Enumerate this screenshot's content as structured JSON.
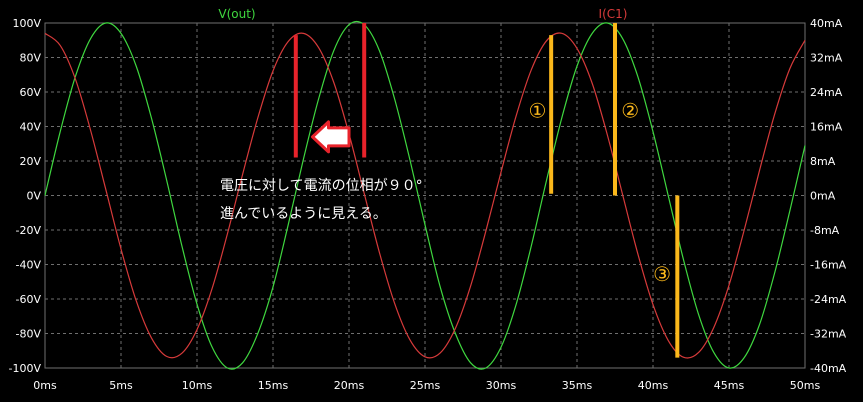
{
  "chart_data": {
    "type": "line",
    "x_axis": {
      "min": 0,
      "max": 50,
      "unit": "ms",
      "ticks": [
        "0ms",
        "5ms",
        "10ms",
        "15ms",
        "20ms",
        "25ms",
        "30ms",
        "35ms",
        "40ms",
        "45ms",
        "50ms"
      ],
      "tick_values": [
        0,
        5,
        10,
        15,
        20,
        25,
        30,
        35,
        40,
        45,
        50
      ]
    },
    "y_left": {
      "min": -100,
      "max": 100,
      "ticks": [
        "100V",
        "80V",
        "60V",
        "40V",
        "20V",
        "0V",
        "-20V",
        "-40V",
        "-60V",
        "-80V",
        "-100V"
      ],
      "tick_values": [
        100,
        80,
        60,
        40,
        20,
        0,
        -20,
        -40,
        -60,
        -80,
        -100
      ]
    },
    "y_right": {
      "min": -40,
      "max": 40,
      "ticks": [
        "40mA",
        "32mA",
        "24mA",
        "16mA",
        "8mA",
        "0mA",
        "-8mA",
        "-16mA",
        "-24mA",
        "-32mA",
        "-40mA"
      ],
      "tick_values": [
        40,
        32,
        24,
        16,
        8,
        0,
        -8,
        -16,
        -24,
        -32,
        -40
      ]
    },
    "grid": true,
    "series": [
      {
        "name": "V(out)",
        "color": "#3fd73f",
        "axis": "left",
        "x": [
          0,
          1,
          2,
          3,
          4,
          5,
          6,
          7,
          8,
          9,
          10,
          11,
          12,
          13,
          14,
          15,
          16,
          17,
          18,
          19,
          20,
          21,
          22,
          23,
          24,
          25,
          26,
          27,
          28,
          29,
          30,
          31,
          32,
          33,
          34,
          35,
          36,
          37,
          38,
          39,
          40,
          41,
          42,
          43,
          44,
          45,
          46,
          47,
          48,
          49,
          50
        ],
        "y": [
          0,
          37,
          69,
          91,
          100,
          94,
          75,
          45,
          9,
          -29,
          -63,
          -88,
          -100,
          -97,
          -80,
          -53,
          -17,
          21,
          56,
          84,
          99,
          99,
          84,
          56,
          21,
          -17,
          -53,
          -80,
          -97,
          -100,
          -88,
          -63,
          -29,
          9,
          45,
          75,
          94,
          100,
          91,
          69,
          37,
          0,
          -37,
          -69,
          -91,
          -100,
          -94,
          -75,
          -45,
          -9,
          29
        ]
      },
      {
        "name": "I(C1)",
        "color": "#d63a3a",
        "axis": "right",
        "x": [
          0,
          1,
          2,
          3,
          4,
          5,
          6,
          7,
          8,
          9,
          10,
          11,
          12,
          13,
          14,
          15,
          16,
          17,
          18,
          19,
          20,
          21,
          22,
          23,
          24,
          25,
          26,
          27,
          28,
          29,
          30,
          31,
          32,
          33,
          34,
          35,
          36,
          37,
          38,
          39,
          40,
          41,
          42,
          43,
          44,
          45,
          46,
          47,
          48,
          49,
          50
        ],
        "y": [
          37.6,
          34.8,
          27.0,
          15.1,
          1.4,
          -12.4,
          -24.4,
          -33.0,
          -37.3,
          -36.6,
          -31.1,
          -21.5,
          -8.9,
          4.9,
          18.0,
          28.9,
          35.7,
          37.6,
          34.3,
          26.2,
          14.3,
          0.5,
          -13.2,
          -25.0,
          -33.4,
          -37.4,
          -36.5,
          -30.8,
          -21.0,
          -8.3,
          5.4,
          18.5,
          29.2,
          35.9,
          37.6,
          34.1,
          26.0,
          14.0,
          0.2,
          -13.5,
          -25.3,
          -33.6,
          -37.5,
          -36.4,
          -30.6,
          -20.8,
          -8.0,
          5.7,
          18.8,
          29.4,
          36.0
        ]
      }
    ],
    "markers": [
      {
        "color": "#e8232b",
        "x": 16.5,
        "y_from": 22,
        "y_to": 93,
        "axis": "left"
      },
      {
        "color": "#e8232b",
        "x": 21.0,
        "y_from": 22,
        "y_to": 100,
        "axis": "left"
      },
      {
        "color": "#fbb81b",
        "x": 33.3,
        "y_from": 1,
        "y_to": 93,
        "axis": "left"
      },
      {
        "color": "#fbb81b",
        "x": 37.5,
        "y_from": 0,
        "y_to": 100,
        "axis": "left"
      },
      {
        "color": "#fbb81b",
        "x": 41.6,
        "y_from": 0,
        "y_to": -94,
        "axis": "left"
      }
    ],
    "annotations": [
      {
        "text": "①",
        "x": 32.4,
        "y": 50
      },
      {
        "text": "②",
        "x": 38.5,
        "y": 50
      },
      {
        "text": "③",
        "x": 40.6,
        "y": -45
      }
    ],
    "note": {
      "lines": [
        "電圧に対して電流の位相が９０°",
        "進んでいるように見える。"
      ]
    },
    "arrow": {
      "x_from": 20.0,
      "x_to": 17.6,
      "y": 34
    }
  },
  "colors": {
    "background": "#000000",
    "grid": "#6f6f6f",
    "axis_text": "#ffffff",
    "note_text": "#ffffff",
    "arrow_fill": "#ffffff",
    "arrow_stroke": "#e8232b"
  }
}
